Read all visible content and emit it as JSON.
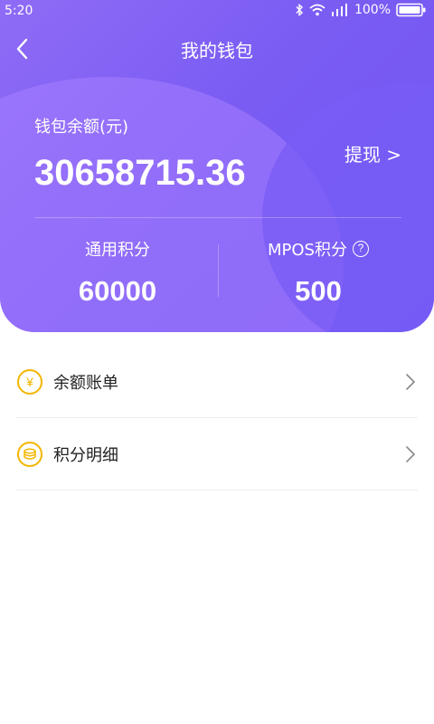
{
  "status_bar": {
    "time": "5:20",
    "battery": "100%",
    "icons": [
      "bluetooth-icon",
      "wifi-icon",
      "signal-icon",
      "battery-icon"
    ]
  },
  "nav": {
    "title": "我的钱包",
    "back_icon": "back-arrow-icon"
  },
  "wallet": {
    "balance_label": "钱包余额(元)",
    "balance_value": "30658715.36",
    "withdraw_label": "提现 >"
  },
  "points": {
    "general": {
      "label": "通用积分",
      "value": "60000"
    },
    "mpos": {
      "label": "MPOS积分",
      "value": "500",
      "help_icon": "?"
    }
  },
  "menu": [
    {
      "label": "余额账单",
      "icon": "yen-coin-icon",
      "icon_glyph": "¥"
    },
    {
      "label": "积分明细",
      "icon": "coin-stack-icon"
    }
  ],
  "colors": {
    "header_gradient_start": "#8f6cf6",
    "header_gradient_end": "#7156f1",
    "icon_accent": "#f2b600"
  }
}
